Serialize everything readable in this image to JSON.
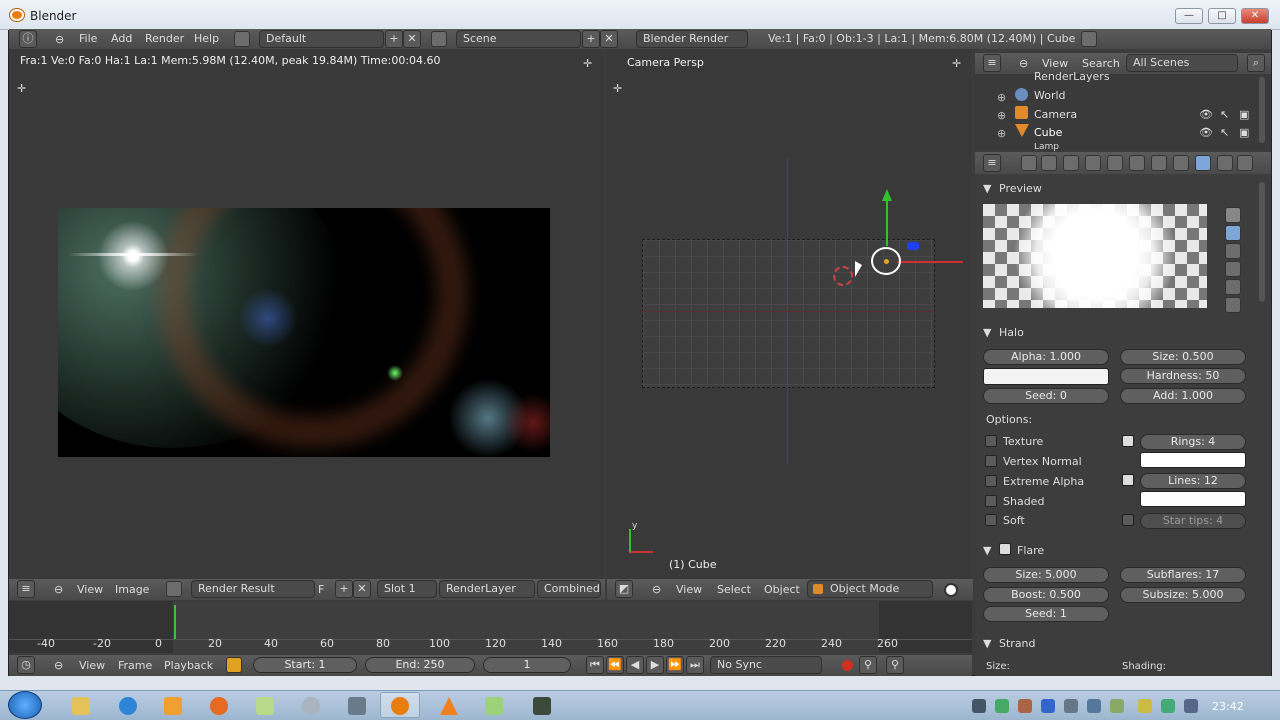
{
  "window": {
    "title": "Blender",
    "min": "—",
    "max": "□",
    "close": "✕"
  },
  "topbar": {
    "menus": [
      "File",
      "Add",
      "Render",
      "Help"
    ],
    "layout": "Default",
    "scene": "Scene",
    "engine": "Blender Render",
    "stats": "Ve:1 | Fa:0 | Ob:1-3 | La:1 | Mem:6.80M (12.40M) | Cube"
  },
  "image_editor": {
    "info": "Fra:1  Ve:0 Fa:0 Ha:1 La:1 Mem:5.98M (12.40M, peak 19.84M) Time:00:04.60",
    "header": {
      "view": "View",
      "image": "Image",
      "image_name": "Render Result",
      "f_label": "F",
      "slot": "Slot 1",
      "layer": "RenderLayer",
      "pass": "Combined"
    }
  },
  "viewport": {
    "label": "Camera Persp",
    "object_label": "(1) Cube",
    "header": {
      "view": "View",
      "select": "Select",
      "object": "Object",
      "mode": "Object Mode"
    }
  },
  "outliner": {
    "view": "View",
    "search": "Search",
    "filter": "All Scenes",
    "items": [
      "RenderLayers",
      "World",
      "Camera",
      "Cube",
      "Lamp"
    ]
  },
  "properties": {
    "preview_title": "Preview",
    "halo_title": "Halo",
    "alpha": "Alpha: 1.000",
    "size": "Size: 0.500",
    "hardness": "Hardness: 50",
    "seed": "Seed: 0",
    "add": "Add: 1.000",
    "options_label": "Options:",
    "texture": "Texture",
    "vertex_normal": "Vertex Normal",
    "extreme_alpha": "Extreme Alpha",
    "shaded": "Shaded",
    "soft": "Soft",
    "rings": "Rings: 4",
    "lines": "Lines: 12",
    "star_tips": "Star tips: 4",
    "flare_title": "Flare",
    "flare_size": "Size: 5.000",
    "subflares": "Subflares: 17",
    "boost": "Boost: 0.500",
    "subsize": "Subsize: 5.000",
    "flare_seed": "Seed: 1",
    "strand_title": "Strand",
    "strand_size": "Size:",
    "strand_shading": "Shading:",
    "halo_color": "#f3f3f3"
  },
  "timeline": {
    "ticks": [
      "-40",
      "-20",
      "0",
      "20",
      "40",
      "60",
      "80",
      "100",
      "120",
      "140",
      "160",
      "180",
      "200",
      "220",
      "240",
      "260"
    ],
    "view": "View",
    "frame": "Frame",
    "playback": "Playback",
    "start": "Start: 1",
    "end": "End: 250",
    "current": "1",
    "sync": "No Sync"
  },
  "taskbar": {
    "time": "23:42"
  }
}
